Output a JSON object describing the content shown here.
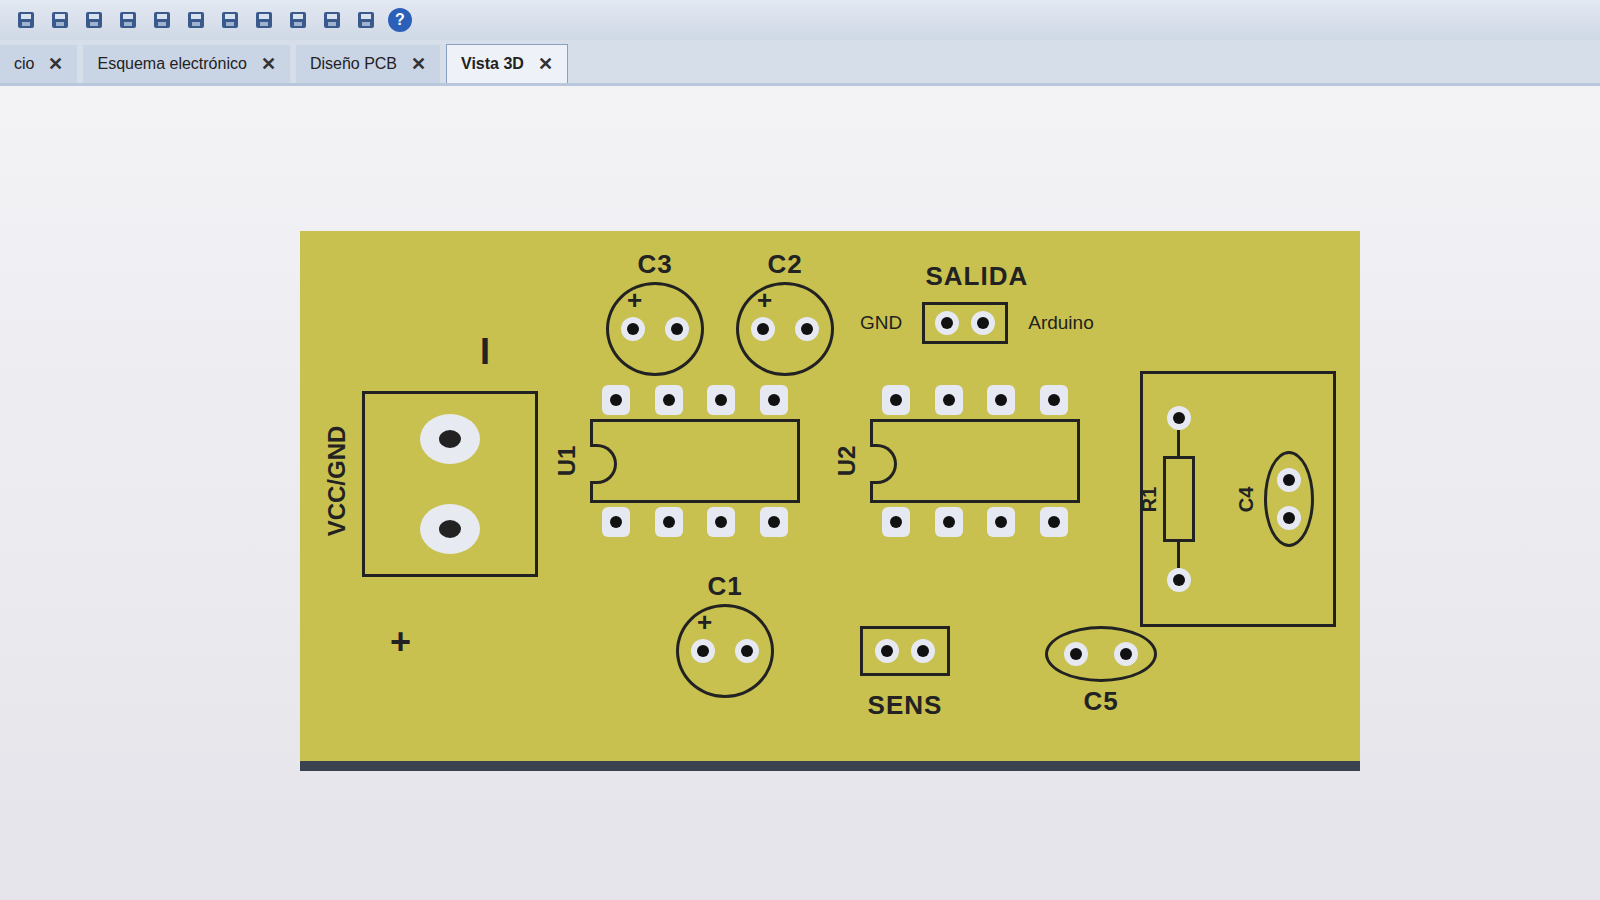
{
  "toolbar": {
    "help": "?"
  },
  "tabs": [
    {
      "label": "cio",
      "selected": false,
      "close": "✕"
    },
    {
      "label": "Esquema electrónico",
      "selected": false,
      "close": "✕"
    },
    {
      "label": "Diseño PCB",
      "selected": false,
      "close": "✕"
    },
    {
      "label": "Vista 3D",
      "selected": true,
      "close": "✕"
    }
  ],
  "board": {
    "marks": [
      {
        "text": "I"
      },
      {
        "text": "+"
      }
    ],
    "terminals": [
      {
        "label": "VCC/GND"
      }
    ],
    "polarized_caps": [
      {
        "label": "C3",
        "polarity": "+"
      },
      {
        "label": "C2",
        "polarity": "+"
      },
      {
        "label": "C1",
        "polarity": "+"
      }
    ],
    "ics": [
      {
        "label": "U1"
      },
      {
        "label": "U2"
      }
    ],
    "output_header": {
      "title": "SALIDA",
      "left": "GND",
      "right": "Arduino"
    },
    "sensor_header": {
      "label": "SENS"
    },
    "ceramic_caps": [
      {
        "label": "C5"
      }
    ],
    "resistor_group": {
      "resistor": "R1",
      "capacitor": "C4"
    }
  }
}
